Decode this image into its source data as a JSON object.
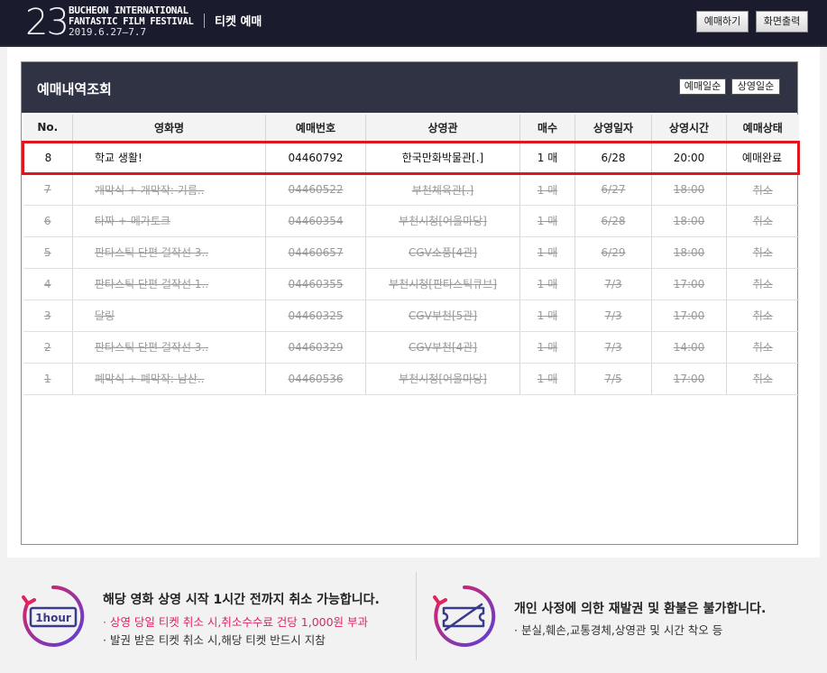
{
  "header": {
    "logo_number": "23",
    "logo_line1": "BUCHEON INTERNATIONAL",
    "logo_line2": "FANTASTIC FILM FESTIVAL",
    "logo_line3": "2019.6.27—7.7",
    "title": "티켓 예매",
    "reserve_button": "예매하기",
    "print_button": "화면출력"
  },
  "panel": {
    "title": "예매내역조회",
    "sort_by_booking": "예매일순",
    "sort_by_screening": "상영일순"
  },
  "table": {
    "columns": [
      "No.",
      "영화명",
      "예매번호",
      "상영관",
      "매수",
      "상영일자",
      "상영시간",
      "예매상태"
    ],
    "rows": [
      {
        "no": "8",
        "title": "학교 생활!",
        "booking_no": "04460792",
        "venue": "한국만화박물관[.]",
        "qty": "1 매",
        "date": "6/28",
        "time": "20:00",
        "status": "예매완료",
        "cancelled": false,
        "highlighted": true
      },
      {
        "no": "7",
        "title": "개막식 + 개막작: 기름..",
        "booking_no": "04460522",
        "venue": "부천체육관[.]",
        "qty": "1 매",
        "date": "6/27",
        "time": "18:00",
        "status": "취소",
        "cancelled": true,
        "highlighted": false
      },
      {
        "no": "6",
        "title": "타짜 + 메가토크",
        "booking_no": "04460354",
        "venue": "부천시청[어울마당]",
        "qty": "1 매",
        "date": "6/28",
        "time": "18:00",
        "status": "취소",
        "cancelled": true,
        "highlighted": false
      },
      {
        "no": "5",
        "title": "판타스틱 단편 걸작선 3..",
        "booking_no": "04460657",
        "venue": "CGV소풍[4관]",
        "qty": "1 매",
        "date": "6/29",
        "time": "18:00",
        "status": "취소",
        "cancelled": true,
        "highlighted": false
      },
      {
        "no": "4",
        "title": "판타스틱 단편 걸작선 1..",
        "booking_no": "04460355",
        "venue": "부천시청[판타스틱큐브]",
        "qty": "1 매",
        "date": "7/3",
        "time": "17:00",
        "status": "취소",
        "cancelled": true,
        "highlighted": false
      },
      {
        "no": "3",
        "title": "달링",
        "booking_no": "04460325",
        "venue": "CGV부천[5관]",
        "qty": "1 매",
        "date": "7/3",
        "time": "17:00",
        "status": "취소",
        "cancelled": true,
        "highlighted": false
      },
      {
        "no": "2",
        "title": "판타스틱 단편 걸작선 3..",
        "booking_no": "04460329",
        "venue": "CGV부천[4관]",
        "qty": "1 매",
        "date": "7/3",
        "time": "14:00",
        "status": "취소",
        "cancelled": true,
        "highlighted": false
      },
      {
        "no": "1",
        "title": "폐막식 + 폐막작: 남산..",
        "booking_no": "04460536",
        "venue": "부천시청[어울마당]",
        "qty": "1 매",
        "date": "7/5",
        "time": "17:00",
        "status": "취소",
        "cancelled": true,
        "highlighted": false
      }
    ]
  },
  "notice": {
    "left_icon_label": "1hour",
    "left_title": "해당 영화 상영 시작 1시간 전까지 취소 가능합니다.",
    "left_line1": "· 상영 당일 티켓 취소 시,취소수수료 건당 1,000원 부과",
    "left_line2": "· 발권 받은 티켓 취소 시,해당 티켓 반드시 지참",
    "right_title": "개인 사정에 의한 재발권 및 환불은 불가합니다.",
    "right_line1": "· 분실,훼손,교통경체,상영관 및 시간 착오 등"
  },
  "colors": {
    "header_bg": "#1b1b2e",
    "panel_head_bg": "#2f3344",
    "highlight_border": "#e0161d",
    "notice_accent": "#e0245e",
    "icon_gradient_start": "#e0245e",
    "icon_gradient_end": "#5a3fd8"
  }
}
